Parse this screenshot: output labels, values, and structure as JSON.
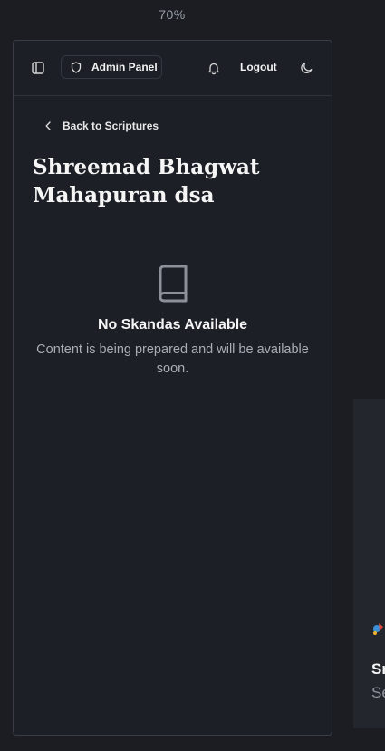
{
  "zoom": "70%",
  "header": {
    "admin_label": "Admin Panel",
    "logout_label": "Logout"
  },
  "back": {
    "label": "Back to Scriptures"
  },
  "page": {
    "title": "Shreemad Bhagwat Mahapuran dsa"
  },
  "empty_state": {
    "title": "No Skandas Available",
    "description": "Content is being prepared and will be available soon."
  },
  "side_card": {
    "title_fragment": "Sr",
    "desc_fragment": "Se"
  },
  "icons": {
    "sidebar": "sidebar-toggle-icon",
    "admin": "shield-icon",
    "notifications": "bell-icon",
    "theme": "moon-icon",
    "back": "chevron-left-icon",
    "empty": "book-icon"
  }
}
